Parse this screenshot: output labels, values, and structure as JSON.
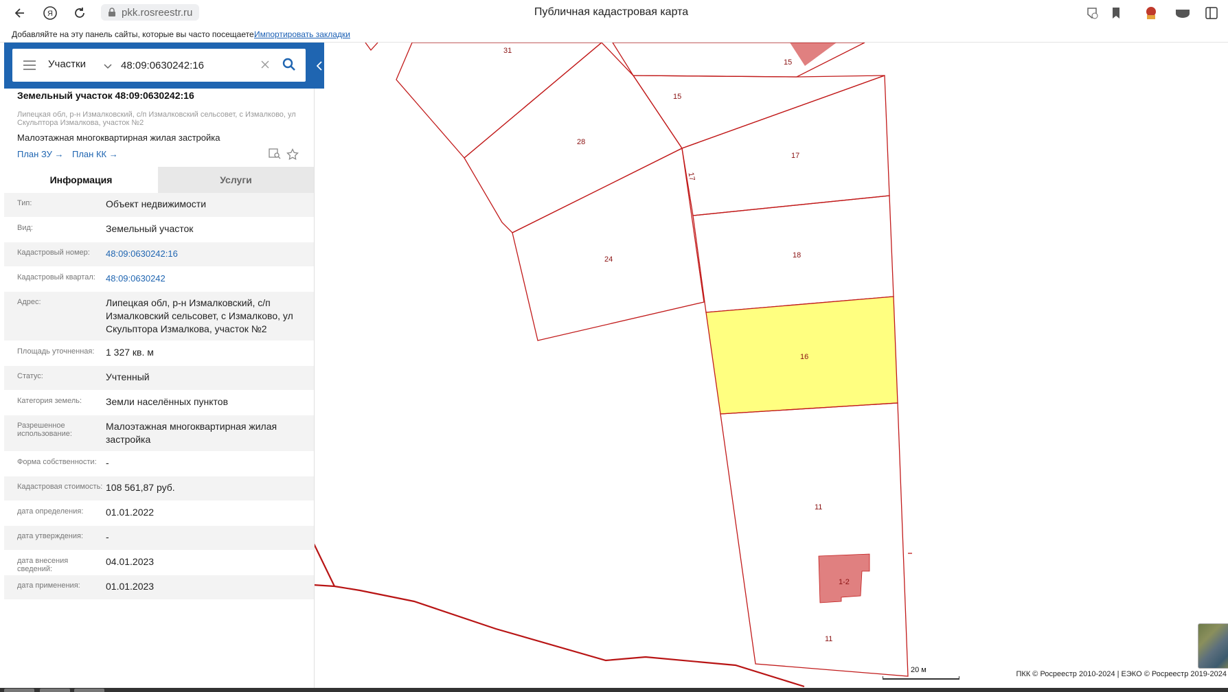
{
  "browser": {
    "url": "pkk.rosreestr.ru",
    "tab_title": "Публичная кадастровая карта",
    "bookmarks_hint": "Добавляйте на эту панель сайты, которые вы часто посещаете.",
    "bookmarks_import": "Импортировать закладки"
  },
  "search": {
    "type": "Участки",
    "value": "48:09:0630242:16"
  },
  "object": {
    "title": "Земельный участок 48:09:0630242:16",
    "address_short": "Липецкая обл, р-н Измалковский, с/п Измалковский сельсовет, с Измалково, ул Скульптора Измалкова, участок №2",
    "use": "Малоэтажная многоквартирная жилая застройка",
    "plan_zu": "План ЗУ →",
    "plan_kk": "План КК →"
  },
  "tabs": {
    "info": "Информация",
    "services": "Услуги"
  },
  "info_rows": [
    {
      "label": "Тип:",
      "value": "Объект недвижимости"
    },
    {
      "label": "Вид:",
      "value": "Земельный участок"
    },
    {
      "label": "Кадастровый номер:",
      "value": "48:09:0630242:16"
    },
    {
      "label": "Кадастровый квартал:",
      "value": "48:09:0630242"
    },
    {
      "label": "Адрес:",
      "value": "Липецкая обл, р-н Измалковский, с/п Измалковский сельсовет, с Измалково, ул Скульптора Измалкова, участок №2"
    },
    {
      "label": "Площадь уточненная:",
      "value": "1 327 кв. м"
    },
    {
      "label": "Статус:",
      "value": "Учтенный"
    },
    {
      "label": "Категория земель:",
      "value": "Земли населённых пунктов"
    },
    {
      "label": "Разрешенное использование:",
      "value": "Малоэтажная многоквартирная жилая застройка"
    },
    {
      "label": "Форма собственности:",
      "value": "-"
    },
    {
      "label": "Кадастровая стоимость:",
      "value": "108 561,87 руб."
    },
    {
      "label": "дата определения:",
      "value": "01.01.2022"
    },
    {
      "label": "дата утверждения:",
      "value": "-"
    },
    {
      "label": "дата внесения сведений:",
      "value": "04.01.2023"
    },
    {
      "label": "дата применения:",
      "value": "01.01.2023"
    }
  ],
  "map": {
    "parcel_labels": [
      "31",
      "15",
      "15",
      "28",
      "17",
      "17",
      "24",
      "18",
      "16",
      "11",
      "1-2",
      "11"
    ],
    "scale": "20 м",
    "attribution": "ПКК © Росреестр 2010-2024 | ЕЭКО © Росреестр 2019-2024",
    "colors": {
      "parcel_stroke": "#c11a1a",
      "selected_fill": "#ffff80",
      "building_fill": "#e08080",
      "panel_header": "#1f65b1"
    }
  }
}
